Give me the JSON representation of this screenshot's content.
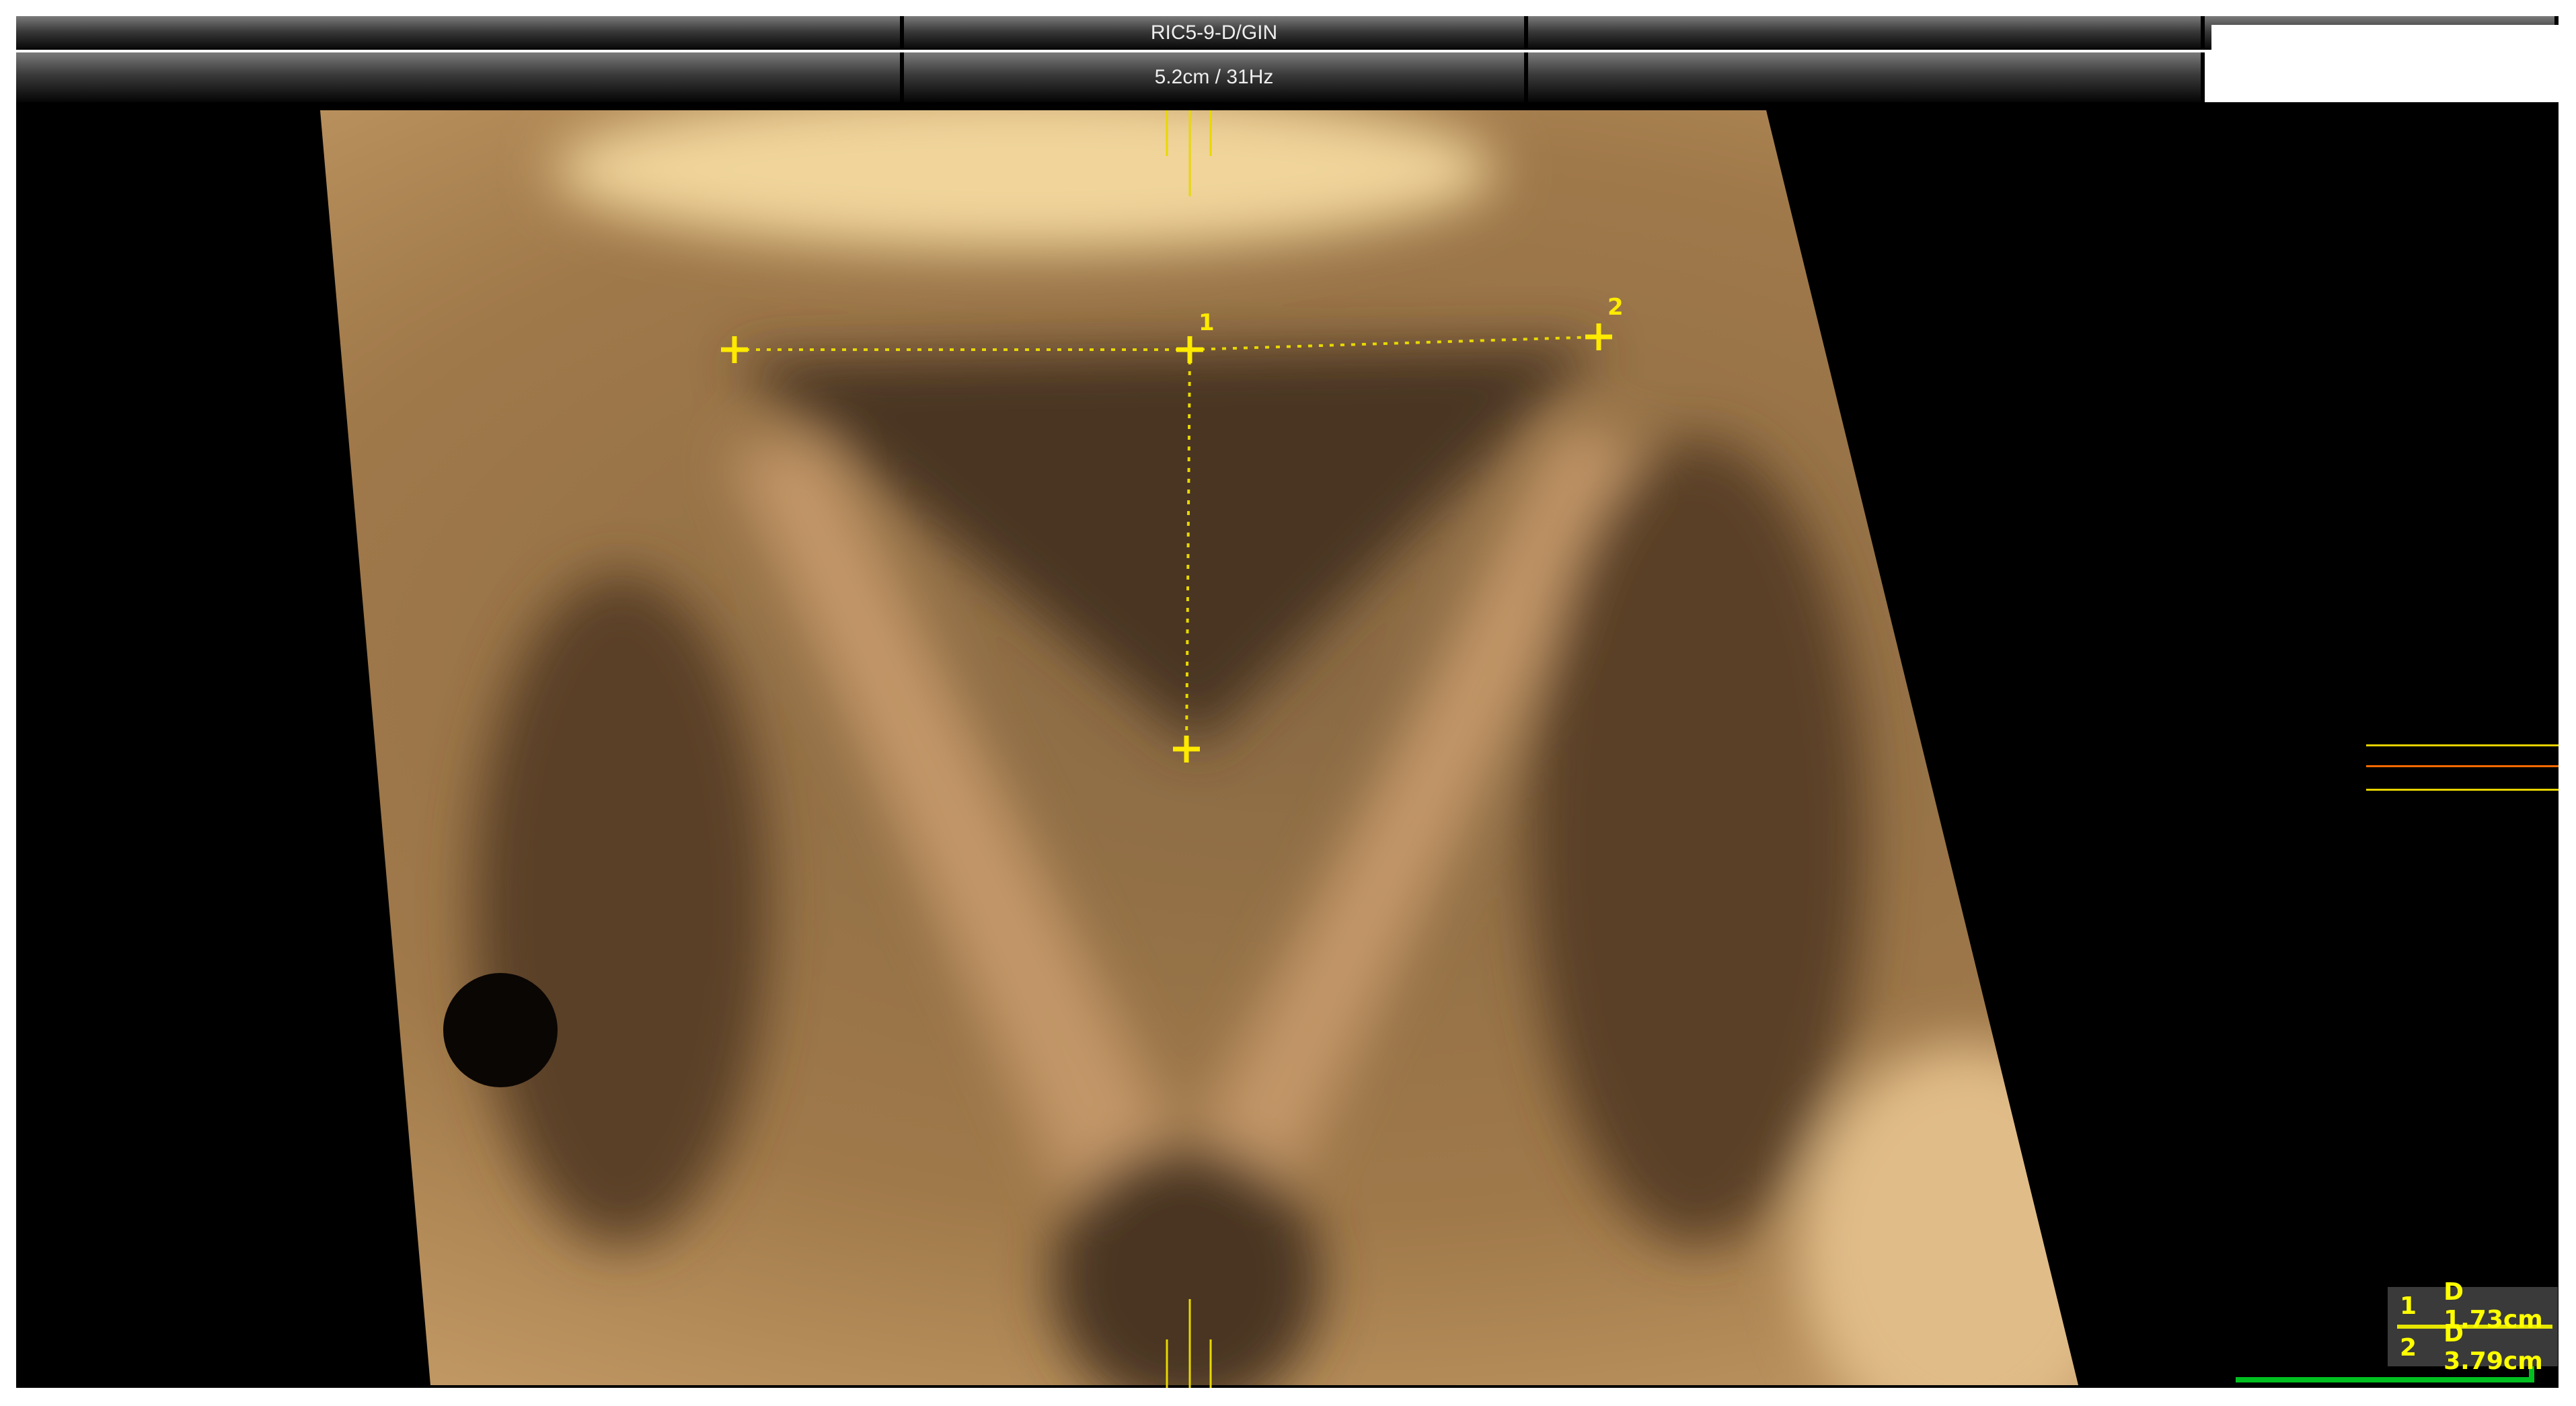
{
  "header": {
    "probe": "RIC5-9-D/GIN",
    "depth_frequency": "5.2cm / 31Hz"
  },
  "markers": [
    {
      "id": "1"
    },
    {
      "id": "2"
    }
  ],
  "results": [
    {
      "index": "1",
      "value": "D 1.73cm"
    },
    {
      "index": "2",
      "value": "D 3.79cm"
    }
  ],
  "colors": {
    "marker": "#ffea00",
    "indicator": "#ff6a00",
    "frame": "#00c020"
  }
}
